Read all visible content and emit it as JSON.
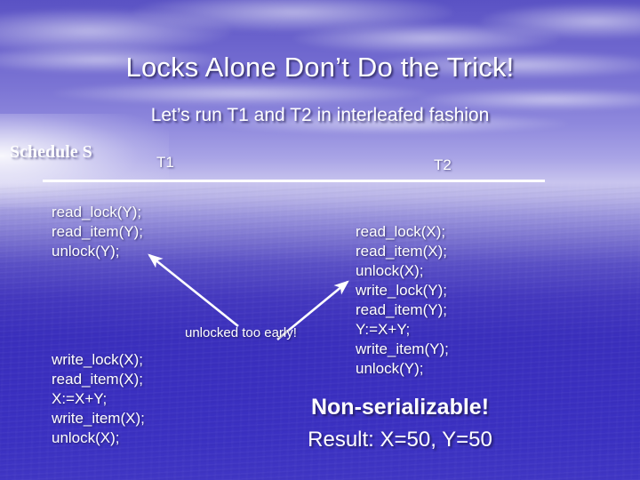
{
  "slide": {
    "title": "Locks Alone Don’t Do the Trick!",
    "subtitle": "Let’s run T1 and T2 in interleafed fashion",
    "schedule_label": "Schedule S",
    "transaction_headers": {
      "t1": "T1",
      "t2": "T2"
    },
    "t1_block_1": "read_lock(Y);\nread_item(Y);\nunlock(Y);",
    "t1_block_2": "write_lock(X);\nread_item(X);\nX:=X+Y;\nwrite_item(X);\nunlock(X);",
    "t2_block": "read_lock(X);\nread_item(X);\nunlock(X);\nwrite_lock(Y);\nread_item(Y);\nY:=X+Y;\nwrite_item(Y);\nunlock(Y);",
    "annotation": "unlocked too early!",
    "conclusion": "Non-serializable!",
    "result": "Result: X=50, Y=50"
  },
  "colors": {
    "text": "#ffffff",
    "sky": "#6a62cc",
    "water": "#3a2fc0",
    "divider": "#ffffff",
    "arrow": "#ffffff"
  },
  "icons": {
    "arrow_left": "arrow-to-t1-unlock",
    "arrow_right": "arrow-to-t2-unlock"
  }
}
